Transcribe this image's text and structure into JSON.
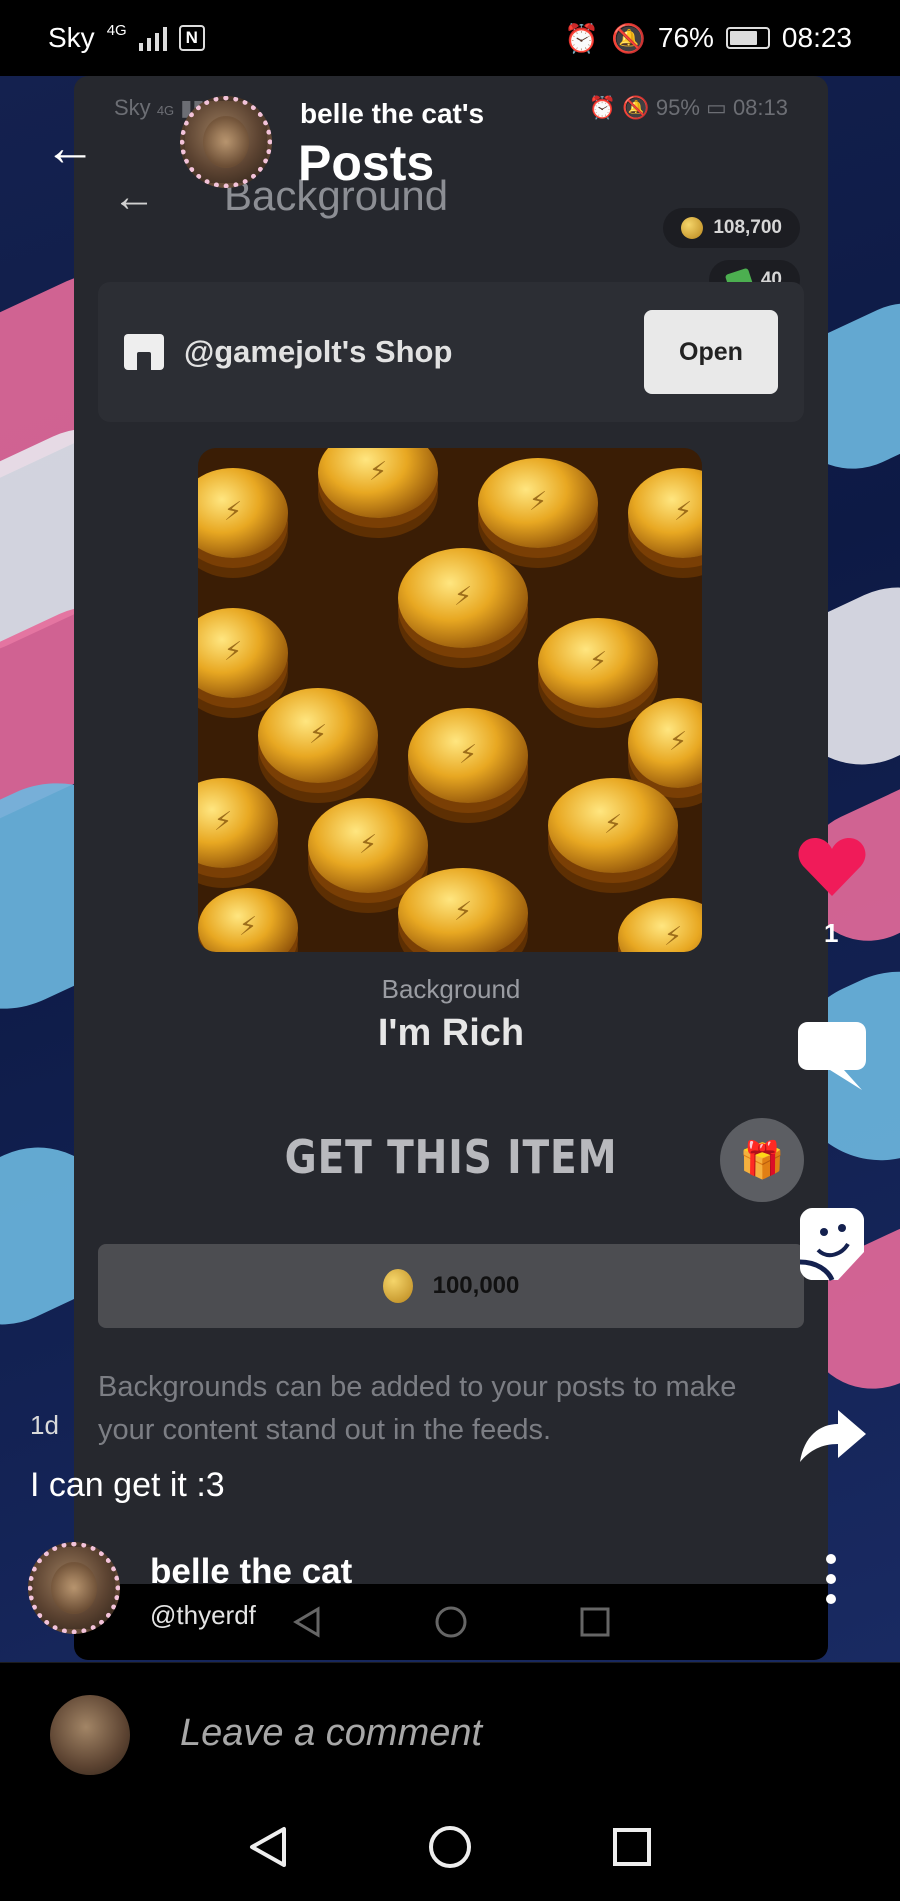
{
  "status_bar": {
    "carrier": "Sky",
    "network": "4G",
    "battery": "76%",
    "time": "08:23"
  },
  "inner_status_bar": {
    "carrier": "Sky",
    "network": "4G",
    "battery": "95%",
    "time": "08:13"
  },
  "header": {
    "user_name": "belle the cat's",
    "title": "Posts"
  },
  "shop_screen": {
    "title": "Background",
    "coins_balance": "108,700",
    "gems_balance": "40",
    "shop_name": "@gamejolt's Shop",
    "open_label": "Open",
    "item_type": "Background",
    "item_name": "I'm Rich",
    "get_item_label": "GET THIS ITEM",
    "price": "100,000",
    "description": "Backgrounds can be added to your posts to make your content stand out in the feeds."
  },
  "actions": {
    "like_count": "1",
    "icons": [
      "heart-icon",
      "comment-icon",
      "sticker-icon",
      "share-icon",
      "more-icon"
    ]
  },
  "post": {
    "time_ago": "1d",
    "caption": "I can get it :3",
    "author_name": "belle the cat",
    "author_handle": "@thyerdf"
  },
  "comment": {
    "placeholder": "Leave a comment"
  },
  "colors": {
    "like": "#f01b59",
    "card_background": "#26282e",
    "accent_pink": "#f3c3da"
  }
}
